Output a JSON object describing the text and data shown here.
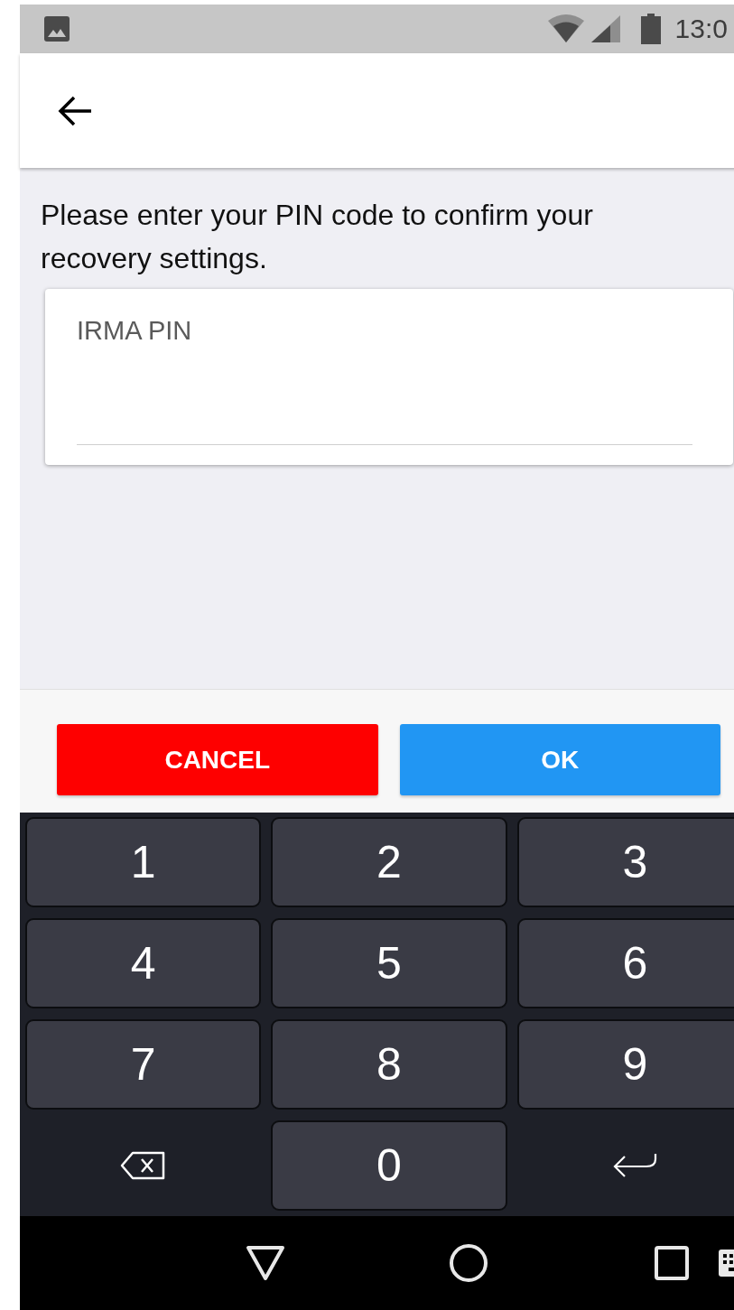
{
  "status_bar": {
    "time": "13:0"
  },
  "prompt": "Please enter your PIN code to confirm your recovery settings.",
  "pin_field": {
    "label": "IRMA PIN"
  },
  "buttons": [
    {
      "label": "CANCEL",
      "kind": "cancel"
    },
    {
      "label": "OK",
      "kind": "confirm"
    }
  ],
  "keypad": [
    {
      "kind": "digit",
      "label": "1"
    },
    {
      "kind": "digit",
      "label": "2"
    },
    {
      "kind": "digit",
      "label": "3"
    },
    {
      "kind": "digit",
      "label": "4"
    },
    {
      "kind": "digit",
      "label": "5"
    },
    {
      "kind": "digit",
      "label": "6"
    },
    {
      "kind": "digit",
      "label": "7"
    },
    {
      "kind": "digit",
      "label": "8"
    },
    {
      "kind": "digit",
      "label": "9"
    },
    {
      "kind": "backspace"
    },
    {
      "kind": "digit",
      "label": "0"
    },
    {
      "kind": "enter"
    }
  ]
}
